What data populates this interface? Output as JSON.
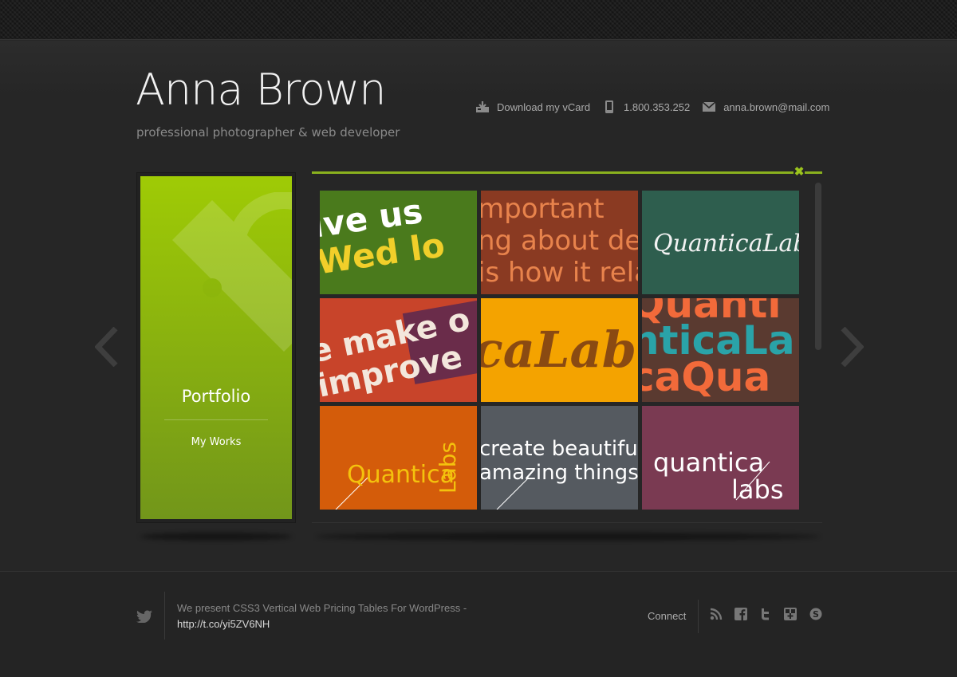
{
  "header": {
    "name": "Anna Brown",
    "tagline": "professional photographer & web developer",
    "contacts": {
      "vcard": "Download my vCard",
      "phone": "1.800.353.252",
      "email": "anna.brown@mail.com"
    }
  },
  "portfolio_tile": {
    "title": "Portfolio",
    "subtitle": "My Works",
    "color": "#8fb80a"
  },
  "gallery": {
    "accent": "#8ab11e",
    "items": [
      {
        "bg": "#4a7a1c",
        "lines": [
          "ive us",
          "Wed lo"
        ]
      },
      {
        "bg": "#8a3a22",
        "lines": [
          "mportant",
          "ng about des",
          "is how it rela"
        ]
      },
      {
        "bg": "#2e5e4e",
        "lines": [
          "QuanticaLabs"
        ]
      },
      {
        "bg": "#c8442a",
        "lines": [
          "e make o",
          "improve"
        ]
      },
      {
        "bg": "#f4a300",
        "lines": [
          "caLab"
        ]
      },
      {
        "bg": "#5a3a30",
        "lines": [
          "Quanti",
          "nticaLa",
          "caQua"
        ]
      },
      {
        "bg": "#d45c0a",
        "lines": [
          "Quantica",
          "Labs"
        ]
      },
      {
        "bg": "#555a60",
        "lines": [
          "create beautiful",
          "amazing things"
        ]
      },
      {
        "bg": "#7a3a52",
        "lines": [
          "quantica",
          "labs"
        ]
      }
    ]
  },
  "footer": {
    "tweet_text": "We present CSS3 Vertical Web Pricing Tables For WordPress - ",
    "tweet_link": "http://t.co/yi5ZV6NH",
    "connect_label": "Connect",
    "social_icons": [
      "rss-icon",
      "facebook-icon",
      "twitter-icon",
      "delicious-icon",
      "skype-icon"
    ]
  }
}
